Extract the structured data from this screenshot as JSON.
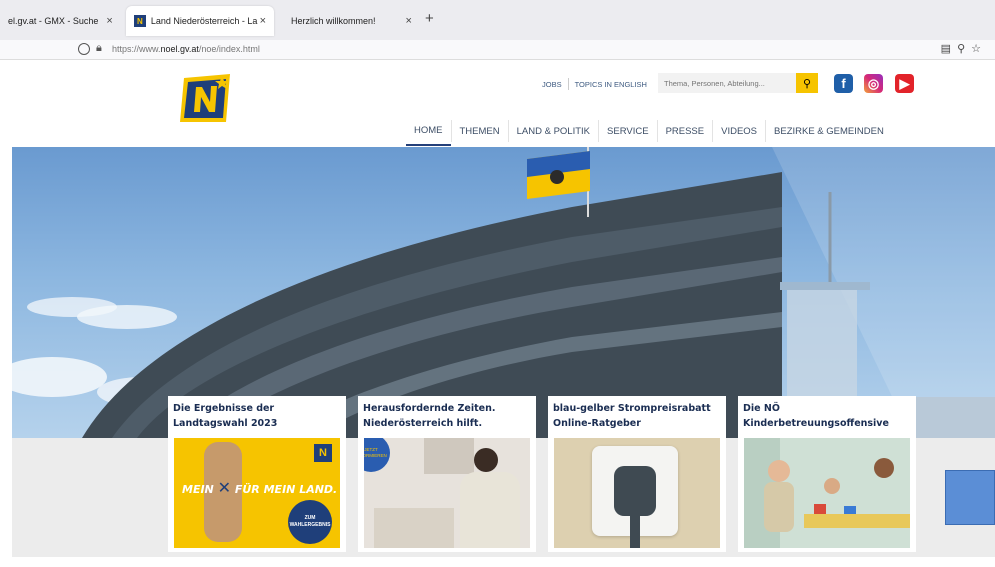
{
  "browser": {
    "tabs": [
      {
        "label": "el.gv.at - GMX - Suche"
      },
      {
        "label": "Land Niederösterreich - Land N"
      },
      {
        "label": "Herzlich willkommen!"
      }
    ],
    "url_prefix": "https://www.",
    "url_domain": "noel.gv.at",
    "url_path": "/noe/index.html"
  },
  "header": {
    "utility": {
      "jobs": "JOBS",
      "topics": "TOPICS IN ENGLISH"
    },
    "search": {
      "placeholder": "Thema, Personen, Abteilung..."
    },
    "nav": [
      {
        "label": "HOME"
      },
      {
        "label": "THEMEN"
      },
      {
        "label": "LAND & POLITIK"
      },
      {
        "label": "SERVICE"
      },
      {
        "label": "PRESSE"
      },
      {
        "label": "VIDEOS"
      },
      {
        "label": "BEZIRKE & GEMEINDEN"
      }
    ]
  },
  "cards": [
    {
      "title": "Die Ergebnisse der Landtagswahl 2023",
      "img_text_main": "MEIN",
      "img_text_rest": "FÜR MEIN LAND.",
      "img_badge": "ZUM WAHLERGEBNIS"
    },
    {
      "title": "Herausfordernde Zeiten. Niederösterreich hilft.",
      "img_badge": "JETZT INFORMIEREN"
    },
    {
      "title": "blau-gelber Strompreisrabatt Online-Ratgeber"
    },
    {
      "title": "Die NÖ Kinderbetreuungsoffensive"
    }
  ],
  "colors": {
    "brand_blue": "#1f3f7a",
    "brand_yellow": "#f6c400",
    "nav_text": "#3d4e66"
  }
}
